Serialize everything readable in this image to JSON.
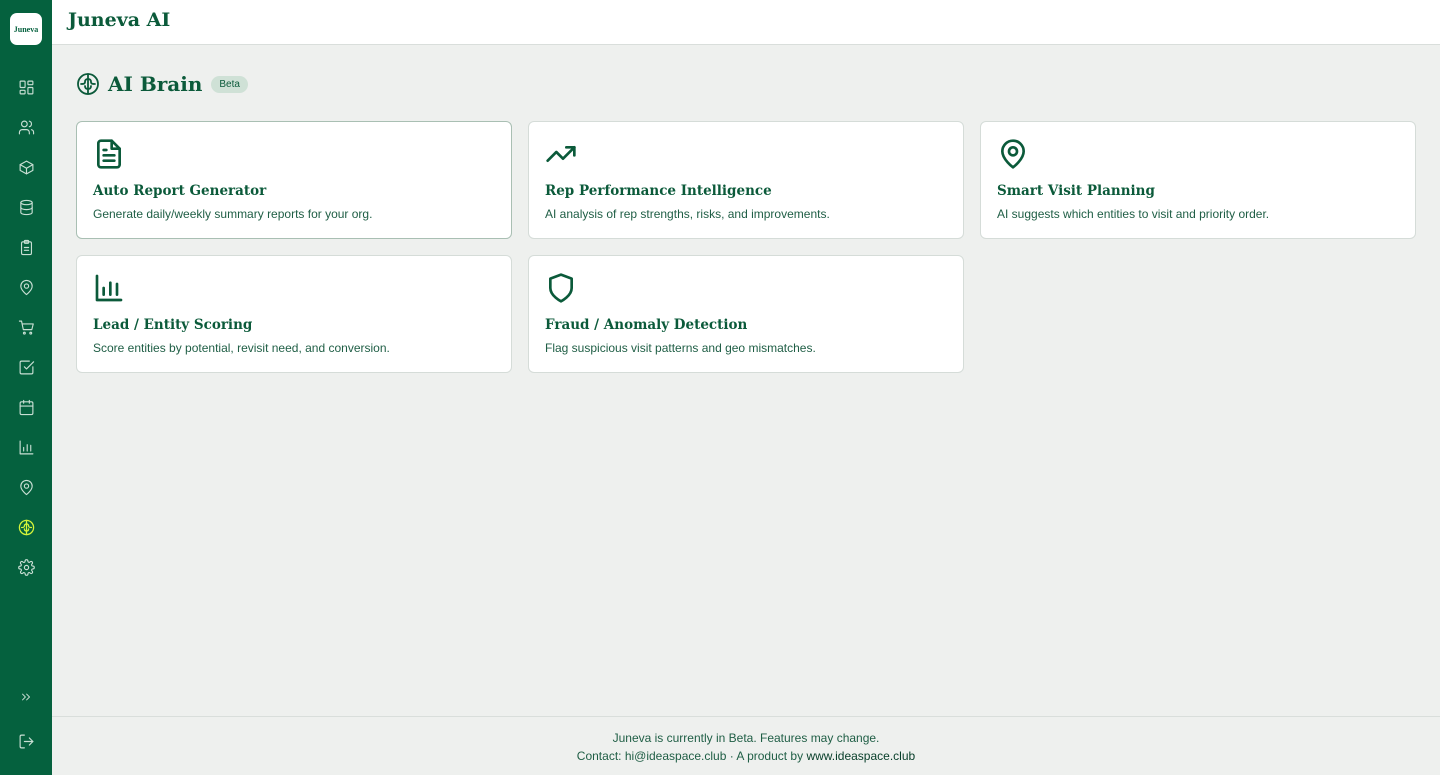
{
  "app": {
    "logo_text": "Juneva",
    "title": "Juneva AI"
  },
  "sidebar": {
    "items": [
      {
        "icon": "dashboard-icon"
      },
      {
        "icon": "users-icon"
      },
      {
        "icon": "box-icon"
      },
      {
        "icon": "database-icon"
      },
      {
        "icon": "clipboard-icon"
      },
      {
        "icon": "map-pin-icon"
      },
      {
        "icon": "cart-icon"
      },
      {
        "icon": "checkbox-icon"
      },
      {
        "icon": "calendar-icon"
      },
      {
        "icon": "bar-chart-icon"
      },
      {
        "icon": "location-icon"
      },
      {
        "icon": "brain-icon",
        "active": true
      },
      {
        "icon": "settings-icon"
      }
    ],
    "expand_icon": "chevrons-right-icon",
    "logout_icon": "logout-icon",
    "active_color": "#d4f43a",
    "background": "#05613e"
  },
  "page": {
    "title": "AI Brain",
    "badge": "Beta",
    "icon": "brain-icon"
  },
  "cards": [
    {
      "icon": "document-icon",
      "title": "Auto Report Generator",
      "description": "Generate daily/weekly summary reports for your org."
    },
    {
      "icon": "trending-up-icon",
      "title": "Rep Performance Intelligence",
      "description": "AI analysis of rep strengths, risks, and improvements."
    },
    {
      "icon": "map-pin-icon",
      "title": "Smart Visit Planning",
      "description": "AI suggests which entities to visit and priority order."
    },
    {
      "icon": "bar-chart-icon",
      "title": "Lead / Entity Scoring",
      "description": "Score entities by potential, revisit need, and conversion."
    },
    {
      "icon": "shield-icon",
      "title": "Fraud / Anomaly Detection",
      "description": "Flag suspicious visit patterns and geo mismatches."
    }
  ],
  "footer": {
    "line1": "Juneva is currently in Beta. Features may change.",
    "line2_prefix": "Contact: hi@ideaspace.club · A product by ",
    "link": "www.ideaspace.club"
  },
  "colors": {
    "accent": "#0b5a3a",
    "page_bg": "#eef0ee"
  }
}
